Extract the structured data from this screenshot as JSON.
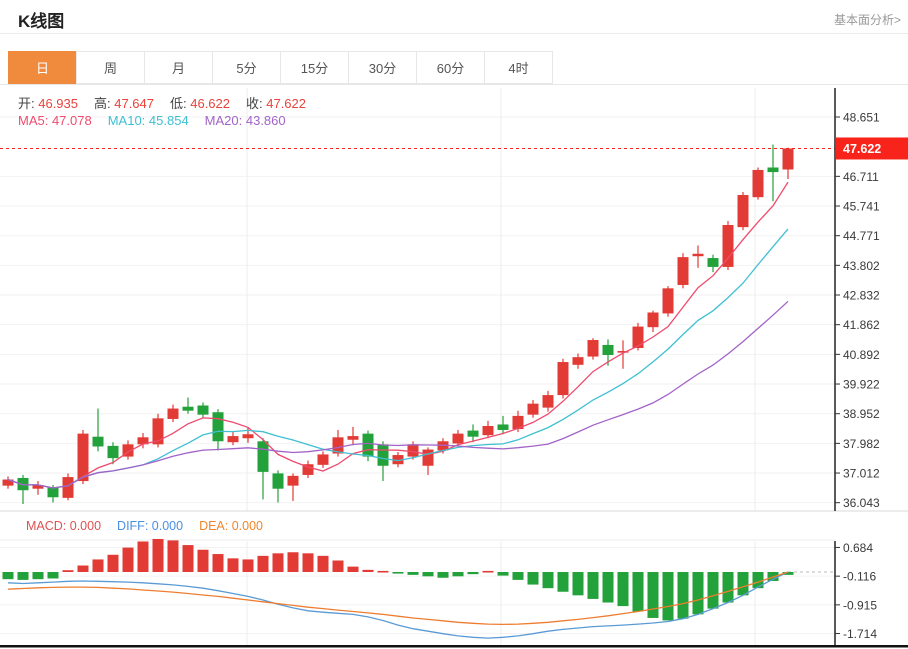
{
  "header": {
    "title": "K线图",
    "analysis_link": "基本面分析>"
  },
  "tabs": [
    {
      "id": "day",
      "label": "日",
      "active": true
    },
    {
      "id": "week",
      "label": "周",
      "active": false
    },
    {
      "id": "month",
      "label": "月",
      "active": false
    },
    {
      "id": "5min",
      "label": "5分",
      "active": false
    },
    {
      "id": "15min",
      "label": "15分",
      "active": false
    },
    {
      "id": "30min",
      "label": "30分",
      "active": false
    },
    {
      "id": "60min",
      "label": "60分",
      "active": false
    },
    {
      "id": "4hour",
      "label": "4时",
      "active": false
    }
  ],
  "ohlc_info": [
    {
      "id": "open",
      "label": "开:",
      "value": "46.935"
    },
    {
      "id": "high",
      "label": "高:",
      "value": "47.647"
    },
    {
      "id": "low",
      "label": "低:",
      "value": "46.622"
    },
    {
      "id": "close",
      "label": "收:",
      "value": "47.622"
    }
  ],
  "ma_info": [
    {
      "id": "ma5",
      "label": "MA5:",
      "value": "47.078",
      "color": "#ef4b6e"
    },
    {
      "id": "ma10",
      "label": "MA10:",
      "value": "45.854",
      "color": "#3ec0d2"
    },
    {
      "id": "ma20",
      "label": "MA20:",
      "value": "43.860",
      "color": "#a263c8"
    }
  ],
  "macd_info": [
    {
      "id": "macd",
      "label": "MACD:",
      "value": "0.000",
      "color": "#dd5252"
    },
    {
      "id": "diff",
      "label": "DIFF:",
      "value": "0.000",
      "color": "#4a90e2"
    },
    {
      "id": "dea",
      "label": "DEA:",
      "value": "0.000",
      "color": "#f0862c"
    }
  ],
  "colors": {
    "up": "#e23a34",
    "down": "#23a13a",
    "price_badge": "#f8231a",
    "price_line": "#f8231a",
    "ma5": "#ef4b6e",
    "ma10": "#3ec0d2",
    "ma20": "#a263c8",
    "diff_line": "#5b9bd5",
    "dea_line": "#ed7d31",
    "active_tab": "#f08a3d"
  },
  "chart_data": [
    {
      "type": "candlestick",
      "title": "K线图 日",
      "y_ticks": [
        48.651,
        46.711,
        45.741,
        44.771,
        43.802,
        42.832,
        41.862,
        40.892,
        39.922,
        38.952,
        37.982,
        37.012,
        36.043
      ],
      "current_price": 47.622,
      "legend": [
        "MA5",
        "MA10",
        "MA20"
      ],
      "ma_periods": [
        5,
        10,
        20
      ],
      "candles_ohlc": [
        [
          36.6,
          36.9,
          36.5,
          36.8
        ],
        [
          36.85,
          36.95,
          36.0,
          36.45
        ],
        [
          36.5,
          36.75,
          36.3,
          36.62
        ],
        [
          36.55,
          36.62,
          36.05,
          36.22
        ],
        [
          36.2,
          37.0,
          36.12,
          36.88
        ],
        [
          36.75,
          38.42,
          36.65,
          38.3
        ],
        [
          38.2,
          39.12,
          37.72,
          37.88
        ],
        [
          37.9,
          38.02,
          37.3,
          37.5
        ],
        [
          37.55,
          38.08,
          37.45,
          37.95
        ],
        [
          37.95,
          38.32,
          37.82,
          38.18
        ],
        [
          37.95,
          38.95,
          37.85,
          38.8
        ],
        [
          38.78,
          39.25,
          38.68,
          39.12
        ],
        [
          39.18,
          39.48,
          38.95,
          39.05
        ],
        [
          39.22,
          39.32,
          38.82,
          38.92
        ],
        [
          39.0,
          39.1,
          37.75,
          38.05
        ],
        [
          38.02,
          38.35,
          37.92,
          38.22
        ],
        [
          38.15,
          38.5,
          38.0,
          38.28
        ],
        [
          38.05,
          38.15,
          36.15,
          37.05
        ],
        [
          37.0,
          37.1,
          36.05,
          36.5
        ],
        [
          36.6,
          37.0,
          36.1,
          36.92
        ],
        [
          36.95,
          37.42,
          36.85,
          37.3
        ],
        [
          37.28,
          37.72,
          37.18,
          37.62
        ],
        [
          37.65,
          38.42,
          37.55,
          38.18
        ],
        [
          38.1,
          38.52,
          37.92,
          38.22
        ],
        [
          38.3,
          38.4,
          37.4,
          37.55
        ],
        [
          37.95,
          38.05,
          36.75,
          37.25
        ],
        [
          37.3,
          37.7,
          37.2,
          37.6
        ],
        [
          37.55,
          38.05,
          37.45,
          37.95
        ],
        [
          37.25,
          37.85,
          36.95,
          37.78
        ],
        [
          37.75,
          38.15,
          37.65,
          38.05
        ],
        [
          37.98,
          38.42,
          37.88,
          38.3
        ],
        [
          38.4,
          38.6,
          38.02,
          38.2
        ],
        [
          38.25,
          38.72,
          38.15,
          38.55
        ],
        [
          38.6,
          38.88,
          38.28,
          38.42
        ],
        [
          38.45,
          39.05,
          38.35,
          38.88
        ],
        [
          38.92,
          39.4,
          38.82,
          39.28
        ],
        [
          39.15,
          39.7,
          39.02,
          39.56
        ],
        [
          39.56,
          40.75,
          39.45,
          40.64
        ],
        [
          40.55,
          40.92,
          40.42,
          40.8
        ],
        [
          40.82,
          41.42,
          40.72,
          41.36
        ],
        [
          41.2,
          41.38,
          40.52,
          40.87
        ],
        [
          40.95,
          41.35,
          40.42,
          41.0
        ],
        [
          41.1,
          41.92,
          41.02,
          41.8
        ],
        [
          41.78,
          42.32,
          41.62,
          42.26
        ],
        [
          42.23,
          43.12,
          42.12,
          43.05
        ],
        [
          43.16,
          44.2,
          43.05,
          44.07
        ],
        [
          44.1,
          44.45,
          43.72,
          44.18
        ],
        [
          44.04,
          44.15,
          43.58,
          43.75
        ],
        [
          43.75,
          45.25,
          43.65,
          45.12
        ],
        [
          45.05,
          46.2,
          44.95,
          46.1
        ],
        [
          46.03,
          47.0,
          45.95,
          46.92
        ],
        [
          47.0,
          47.75,
          45.9,
          46.85
        ],
        [
          46.935,
          47.647,
          46.622,
          47.622
        ]
      ]
    },
    {
      "type": "bar",
      "title": "MACD",
      "y_ticks": [
        0.684,
        -0.116,
        -0.915,
        -1.714
      ],
      "histogram": [
        -0.2,
        -0.22,
        -0.2,
        -0.18,
        0.05,
        0.18,
        0.35,
        0.48,
        0.68,
        0.85,
        0.92,
        0.88,
        0.75,
        0.62,
        0.5,
        0.38,
        0.35,
        0.45,
        0.52,
        0.55,
        0.52,
        0.45,
        0.32,
        0.15,
        0.06,
        0.03,
        -0.04,
        -0.08,
        -0.12,
        -0.16,
        -0.12,
        -0.06,
        0.03,
        -0.1,
        -0.22,
        -0.35,
        -0.45,
        -0.55,
        -0.65,
        -0.75,
        -0.85,
        -0.95,
        -1.1,
        -1.28,
        -1.35,
        -1.3,
        -1.18,
        -1.02,
        -0.85,
        -0.65,
        -0.45,
        -0.25,
        -0.08
      ],
      "series": [
        {
          "name": "DIFF",
          "color": "#5b9bd5",
          "values": [
            -0.3,
            -0.32,
            -0.3,
            -0.28,
            -0.26,
            -0.25,
            -0.26,
            -0.27,
            -0.28,
            -0.3,
            -0.33,
            -0.36,
            -0.4,
            -0.45,
            -0.52,
            -0.6,
            -0.68,
            -0.78,
            -0.9,
            -1.0,
            -1.08,
            -1.12,
            -1.15,
            -1.18,
            -1.25,
            -1.35,
            -1.48,
            -1.58,
            -1.65,
            -1.72,
            -1.78,
            -1.82,
            -1.84,
            -1.82,
            -1.78,
            -1.72,
            -1.65,
            -1.6,
            -1.56,
            -1.52,
            -1.5,
            -1.48,
            -1.45,
            -1.42,
            -1.38,
            -1.3,
            -1.18,
            -1.02,
            -0.85,
            -0.65,
            -0.42,
            -0.2,
            0.0
          ]
        },
        {
          "name": "DEA",
          "color": "#ed7d31",
          "values": [
            -0.48,
            -0.46,
            -0.44,
            -0.43,
            -0.42,
            -0.42,
            -0.43,
            -0.45,
            -0.47,
            -0.5,
            -0.53,
            -0.56,
            -0.6,
            -0.64,
            -0.68,
            -0.73,
            -0.78,
            -0.83,
            -0.88,
            -0.93,
            -0.98,
            -1.02,
            -1.06,
            -1.1,
            -1.14,
            -1.18,
            -1.23,
            -1.28,
            -1.32,
            -1.36,
            -1.4,
            -1.43,
            -1.45,
            -1.46,
            -1.45,
            -1.43,
            -1.4,
            -1.36,
            -1.32,
            -1.27,
            -1.22,
            -1.16,
            -1.1,
            -1.03,
            -0.96,
            -0.88,
            -0.78,
            -0.66,
            -0.54,
            -0.41,
            -0.28,
            -0.14,
            0.0
          ]
        }
      ]
    }
  ]
}
